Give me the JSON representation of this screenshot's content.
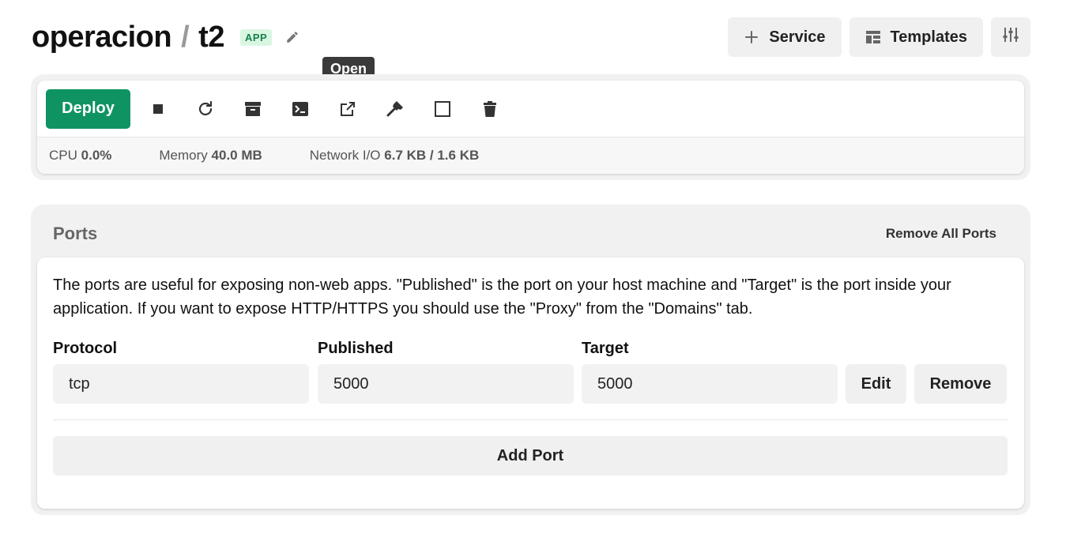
{
  "header": {
    "project": "operacion",
    "separator": "/",
    "service": "t2",
    "badge": "APP",
    "actions": {
      "service_label": "Service",
      "templates_label": "Templates"
    }
  },
  "tooltip": "Open",
  "toolbar": {
    "deploy_label": "Deploy",
    "icons": [
      "stop-icon",
      "restart-icon",
      "archive-icon",
      "terminal-icon",
      "open-external-icon",
      "build-hammer-icon",
      "square-icon",
      "trash-icon"
    ]
  },
  "stats": {
    "cpu_label": "CPU",
    "cpu_value": "0.0%",
    "memory_label": "Memory",
    "memory_value": "40.0 MB",
    "network_label": "Network I/O",
    "network_value": "6.7 KB / 1.6 KB"
  },
  "ports": {
    "title": "Ports",
    "remove_all_label": "Remove All Ports",
    "description": "The ports are useful for exposing non-web apps. \"Published\" is the port on your host machine and \"Target\" is the port inside your application. If you want to expose HTTP/HTTPS you should use the \"Proxy\" from the \"Domains\" tab.",
    "columns": {
      "protocol": "Protocol",
      "published": "Published",
      "target": "Target"
    },
    "rows": [
      {
        "protocol": "tcp",
        "published": "5000",
        "target": "5000"
      }
    ],
    "edit_label": "Edit",
    "remove_label": "Remove",
    "add_label": "Add Port"
  },
  "colors": {
    "accent": "#109363",
    "badge_bg": "#d9f6e3",
    "badge_text": "#17804a"
  }
}
